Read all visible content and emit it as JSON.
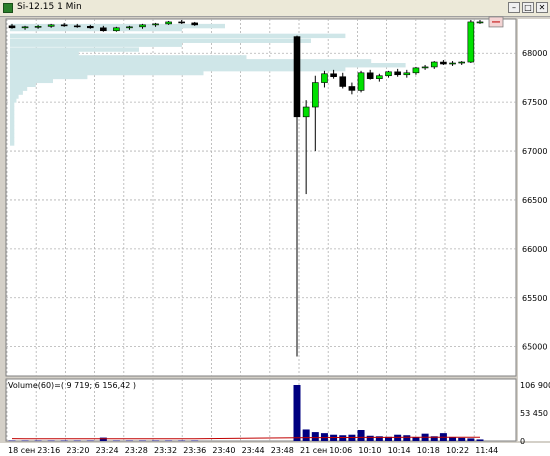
{
  "window": {
    "title": "Si-12.15 1 Min",
    "buttons": {
      "minimize": "–",
      "maximize": "□",
      "close": "✕"
    }
  },
  "chart_data": {
    "type": "candlestick",
    "title": "Si-12.15 1 Min",
    "ylim": [
      64700,
      68350
    ],
    "y_ticks": [
      {
        "v": 68000,
        "label": "68000"
      },
      {
        "v": 67500,
        "label": "67500"
      },
      {
        "v": 67000,
        "label": "67000"
      },
      {
        "v": 66500,
        "label": "66500"
      },
      {
        "v": 66000,
        "label": "66000"
      },
      {
        "v": 65500,
        "label": "65500"
      },
      {
        "v": 65000,
        "label": "65000"
      }
    ],
    "x_ticks": [
      "18 сен",
      "23:16",
      "23:20",
      "23:24",
      "23:28",
      "23:32",
      "23:36",
      "23:40",
      "23:44",
      "23:48",
      "21 сен",
      "10:06",
      "10:10",
      "10:14",
      "10:18",
      "10:22",
      "11:44"
    ],
    "candles": [
      {
        "o": 68280,
        "h": 68300,
        "l": 68250,
        "c": 68260
      },
      {
        "o": 68260,
        "h": 68280,
        "l": 68240,
        "c": 68270
      },
      {
        "o": 68270,
        "h": 68290,
        "l": 68250,
        "c": 68275
      },
      {
        "o": 68275,
        "h": 68300,
        "l": 68260,
        "c": 68290
      },
      {
        "o": 68290,
        "h": 68310,
        "l": 68270,
        "c": 68280
      },
      {
        "o": 68280,
        "h": 68300,
        "l": 68260,
        "c": 68275
      },
      {
        "o": 68275,
        "h": 68290,
        "l": 68250,
        "c": 68260
      },
      {
        "o": 68260,
        "h": 68280,
        "l": 68220,
        "c": 68230
      },
      {
        "o": 68230,
        "h": 68270,
        "l": 68220,
        "c": 68260
      },
      {
        "o": 68260,
        "h": 68280,
        "l": 68240,
        "c": 68270
      },
      {
        "o": 68270,
        "h": 68300,
        "l": 68250,
        "c": 68290
      },
      {
        "o": 68290,
        "h": 68310,
        "l": 68270,
        "c": 68300
      },
      {
        "o": 68300,
        "h": 68330,
        "l": 68290,
        "c": 68320
      },
      {
        "o": 68320,
        "h": 68340,
        "l": 68300,
        "c": 68310
      },
      {
        "o": 68310,
        "h": 68320,
        "l": 68280,
        "c": 68290
      },
      {
        "o": 68170,
        "h": 68180,
        "l": 64900,
        "c": 67350
      },
      {
        "o": 67350,
        "h": 67520,
        "l": 66560,
        "c": 67450
      },
      {
        "o": 67450,
        "h": 67770,
        "l": 67000,
        "c": 67700
      },
      {
        "o": 67700,
        "h": 67820,
        "l": 67650,
        "c": 67790
      },
      {
        "o": 67790,
        "h": 67830,
        "l": 67740,
        "c": 67760
      },
      {
        "o": 67760,
        "h": 67800,
        "l": 67640,
        "c": 67660
      },
      {
        "o": 67660,
        "h": 67700,
        "l": 67580,
        "c": 67620
      },
      {
        "o": 67620,
        "h": 67820,
        "l": 67600,
        "c": 67800
      },
      {
        "o": 67800,
        "h": 67830,
        "l": 67730,
        "c": 67740
      },
      {
        "o": 67740,
        "h": 67790,
        "l": 67710,
        "c": 67770
      },
      {
        "o": 67770,
        "h": 67820,
        "l": 67750,
        "c": 67810
      },
      {
        "o": 67810,
        "h": 67840,
        "l": 67760,
        "c": 67780
      },
      {
        "o": 67780,
        "h": 67830,
        "l": 67750,
        "c": 67800
      },
      {
        "o": 67800,
        "h": 67860,
        "l": 67780,
        "c": 67850
      },
      {
        "o": 67850,
        "h": 67880,
        "l": 67830,
        "c": 67860
      },
      {
        "o": 67860,
        "h": 67920,
        "l": 67840,
        "c": 67910
      },
      {
        "o": 67910,
        "h": 67930,
        "l": 67880,
        "c": 67890
      },
      {
        "o": 67890,
        "h": 67920,
        "l": 67870,
        "c": 67900
      },
      {
        "o": 67900,
        "h": 67920,
        "l": 67880,
        "c": 67910
      },
      {
        "o": 67910,
        "h": 68340,
        "l": 67900,
        "c": 68320
      },
      {
        "o": 68320,
        "h": 68340,
        "l": 68300,
        "c": 68320
      }
    ],
    "volume_profile": [
      {
        "price": 68280,
        "level": 0.5
      },
      {
        "price": 68250,
        "level": 0.4
      },
      {
        "price": 68180,
        "level": 0.78
      },
      {
        "price": 68130,
        "level": 0.7
      },
      {
        "price": 68090,
        "level": 0.4
      },
      {
        "price": 68040,
        "level": 0.3
      },
      {
        "price": 68000,
        "level": 0.16
      },
      {
        "price": 67960,
        "level": 0.55
      },
      {
        "price": 67920,
        "level": 0.84
      },
      {
        "price": 67880,
        "level": 0.92
      },
      {
        "price": 67840,
        "level": 0.78
      },
      {
        "price": 67800,
        "level": 0.45
      },
      {
        "price": 67760,
        "level": 0.18
      },
      {
        "price": 67720,
        "level": 0.1
      },
      {
        "price": 67680,
        "level": 0.06
      },
      {
        "price": 67640,
        "level": 0.04
      },
      {
        "price": 67600,
        "level": 0.03
      },
      {
        "price": 67560,
        "level": 0.02
      },
      {
        "price": 67520,
        "level": 0.015
      },
      {
        "price": 67480,
        "level": 0.01
      },
      {
        "price": 67440,
        "level": 0.01
      },
      {
        "price": 67400,
        "level": 0.01
      },
      {
        "price": 67360,
        "level": 0.01
      },
      {
        "price": 67320,
        "level": 0.01
      },
      {
        "price": 67280,
        "level": 0.01
      },
      {
        "price": 67240,
        "level": 0.01
      },
      {
        "price": 67200,
        "level": 0.01
      },
      {
        "price": 67160,
        "level": 0.01
      },
      {
        "price": 67120,
        "level": 0.01
      },
      {
        "price": 67080,
        "level": 0.01
      }
    ],
    "price_marker": 68320,
    "volume": {
      "label": "Volume(60)=( 9 719; 6 156,42 )",
      "ylim": [
        0,
        106900
      ],
      "y_ticks": [
        {
          "v": 106900,
          "label": "106 900"
        },
        {
          "v": 53450,
          "label": "53 450"
        },
        {
          "v": 0,
          "label": "0"
        }
      ],
      "values": [
        900,
        900,
        900,
        900,
        900,
        900,
        900,
        6500,
        900,
        900,
        900,
        900,
        900,
        900,
        900,
        106900,
        22000,
        17000,
        15000,
        12000,
        11000,
        12000,
        21000,
        10000,
        9000,
        8000,
        12000,
        11000,
        7000,
        14000,
        9000,
        15000,
        7000,
        6000,
        5000,
        3000
      ],
      "ma": [
        4500,
        4400,
        4400,
        4400,
        4350,
        4300,
        4300,
        4400,
        4350,
        4300,
        4300,
        4300,
        4300,
        4300,
        4300,
        6300,
        6400,
        6500,
        6550,
        6600,
        6650,
        6700,
        6850,
        6900,
        6950,
        6950,
        7000,
        7050,
        7050,
        7100,
        7100,
        7150,
        7150,
        7150,
        7150,
        7150
      ],
      "bar_color": "#000080",
      "ma_color": "#c00000"
    },
    "colors": {
      "up": "#00e000",
      "down": "#000000",
      "profile": "#cfe6e8",
      "grid": "#b0b0b0",
      "background": "#ffffff"
    },
    "grid": true
  }
}
